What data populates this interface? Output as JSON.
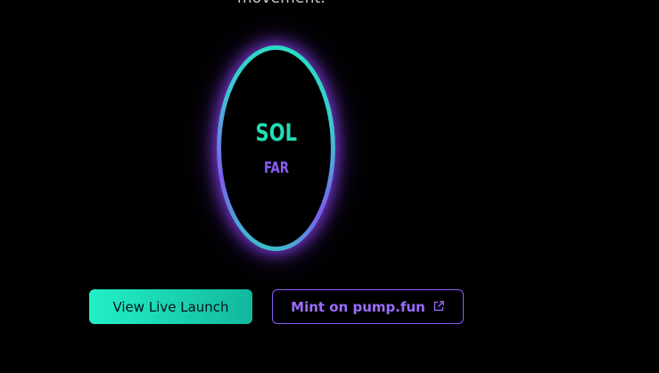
{
  "hero": {
    "clipped_text": "movement."
  },
  "logo": {
    "primary_text": "SOL",
    "secondary_text": "FAR",
    "ring_colors": [
      "#22e3c0",
      "#7c5cf0"
    ],
    "glow_color": "#9646ff"
  },
  "actions": {
    "primary_label": "View Live Launch",
    "secondary_label": "Mint on pump.fun",
    "secondary_icon": "external-link-icon",
    "primary_color": "#22f0c6",
    "secondary_color": "#8a5cf6"
  }
}
